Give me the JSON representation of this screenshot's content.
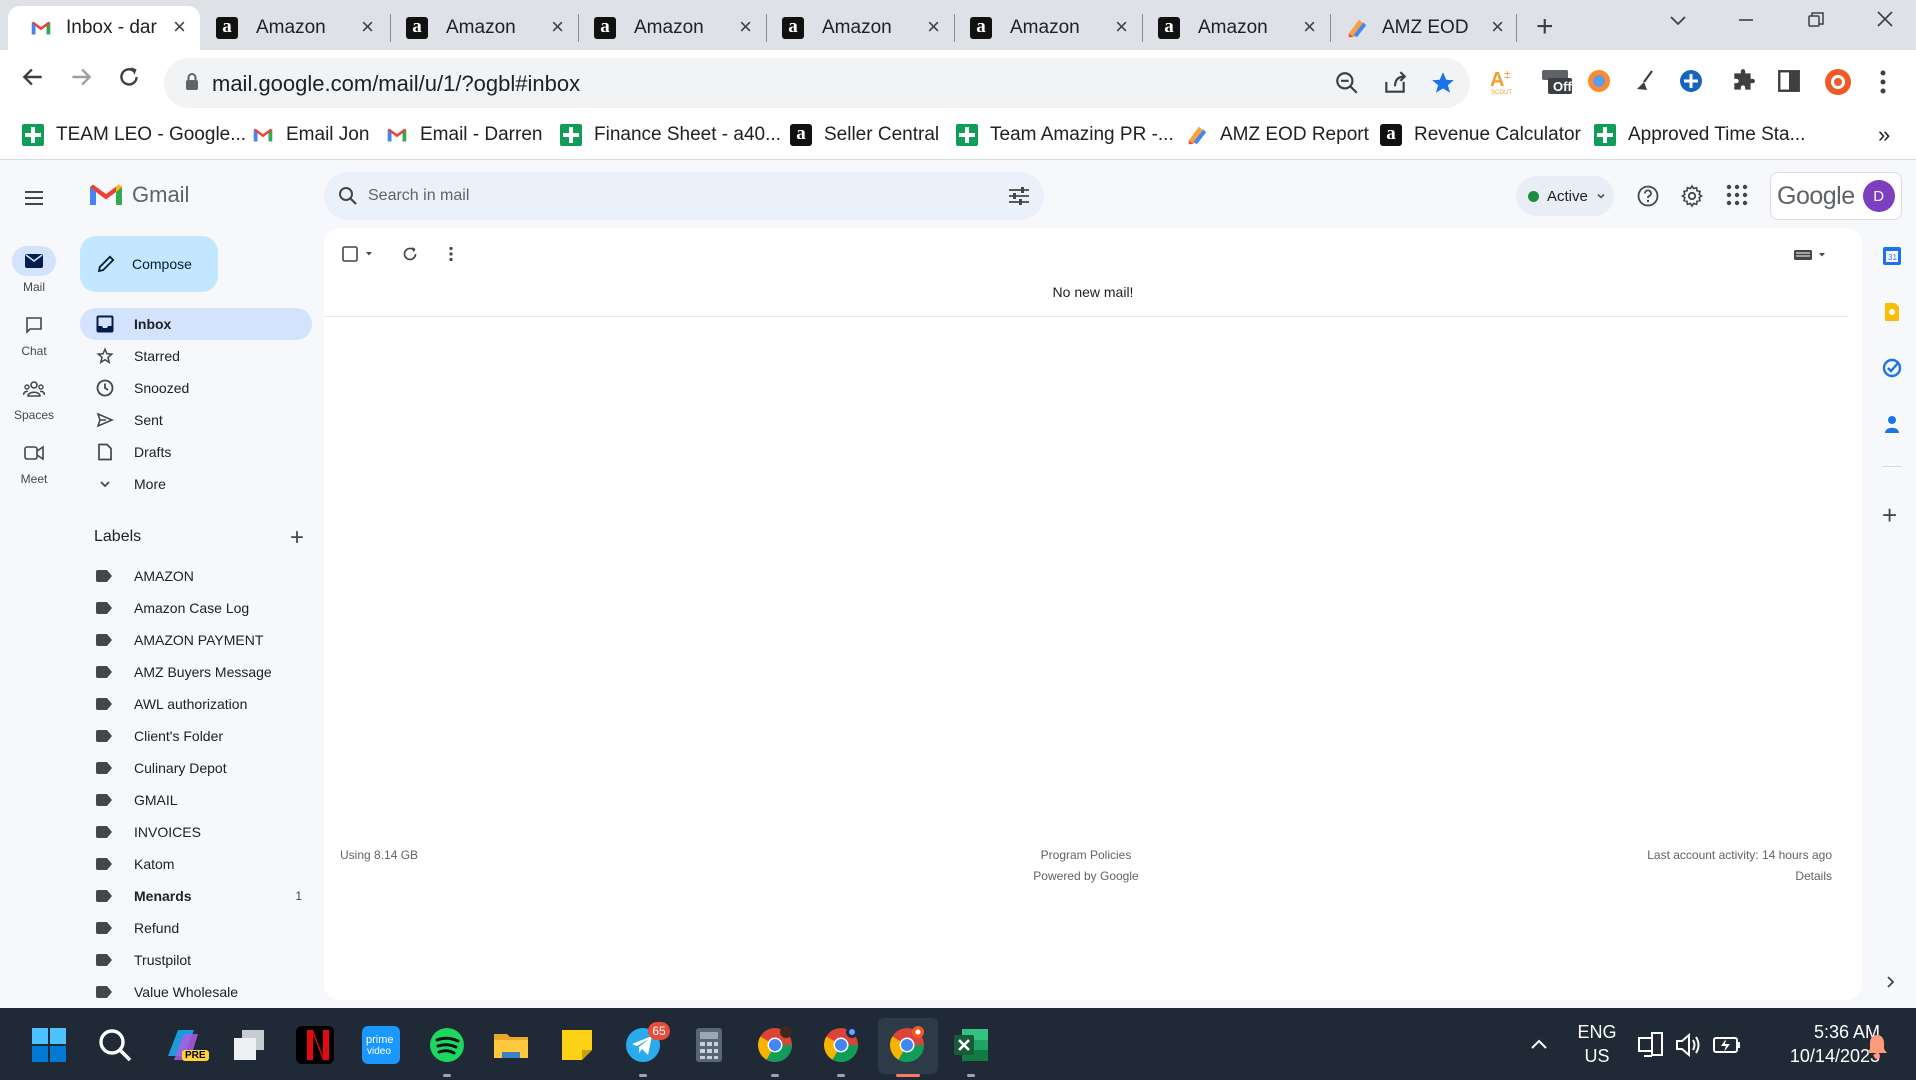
{
  "browser": {
    "tabs": [
      {
        "title": "Inbox - dar",
        "favicon": "gmail-icon",
        "active": true
      },
      {
        "title": "Amazon",
        "favicon": "amazon-icon"
      },
      {
        "title": "Amazon",
        "favicon": "amazon-icon"
      },
      {
        "title": "Amazon",
        "favicon": "amazon-icon"
      },
      {
        "title": "Amazon",
        "favicon": "amazon-icon"
      },
      {
        "title": "Amazon",
        "favicon": "amazon-icon"
      },
      {
        "title": "Amazon",
        "favicon": "amazon-icon"
      },
      {
        "title": "AMZ EOD",
        "favicon": "eod-icon"
      }
    ],
    "url": "mail.google.com/mail/u/1/?ogbl#inbox",
    "ext_off_label": "Off",
    "bookmarks": [
      {
        "label": "TEAM LEO - Google...",
        "icon": "sheets-icon"
      },
      {
        "label": "Email Jon",
        "icon": "gmail-icon"
      },
      {
        "label": "Email - Darren",
        "icon": "gmail-icon"
      },
      {
        "label": "Finance Sheet - a40...",
        "icon": "sheets-icon"
      },
      {
        "label": "Seller Central",
        "icon": "amazon-icon"
      },
      {
        "label": "Team Amazing PR -...",
        "icon": "sheets-icon"
      },
      {
        "label": "AMZ EOD Report",
        "icon": "eod-icon"
      },
      {
        "label": "Revenue Calculator",
        "icon": "amazon-icon"
      },
      {
        "label": "Approved Time Sta...",
        "icon": "sheets-icon"
      }
    ],
    "bookmarks_overflow": "»"
  },
  "gmail": {
    "app_name": "Gmail",
    "search_placeholder": "Search in mail",
    "status": "Active",
    "google_text": "Google",
    "avatar_initial": "D",
    "compose_label": "Compose",
    "rail": [
      {
        "label": "Mail",
        "icon": "mail-icon"
      },
      {
        "label": "Chat",
        "icon": "chat-icon"
      },
      {
        "label": "Spaces",
        "icon": "spaces-icon"
      },
      {
        "label": "Meet",
        "icon": "meet-icon"
      }
    ],
    "nav": [
      {
        "label": "Inbox",
        "icon": "inbox-icon"
      },
      {
        "label": "Starred",
        "icon": "star-icon"
      },
      {
        "label": "Snoozed",
        "icon": "clock-icon"
      },
      {
        "label": "Sent",
        "icon": "send-icon"
      },
      {
        "label": "Drafts",
        "icon": "draft-icon"
      },
      {
        "label": "More",
        "icon": "chevron-down-icon"
      }
    ],
    "labels_title": "Labels",
    "labels": [
      {
        "name": "AMAZON",
        "count": ""
      },
      {
        "name": "Amazon Case Log",
        "count": ""
      },
      {
        "name": "AMAZON PAYMENT",
        "count": ""
      },
      {
        "name": "AMZ Buyers Message",
        "count": ""
      },
      {
        "name": "AWL authorization",
        "count": ""
      },
      {
        "name": "Client's Folder",
        "count": ""
      },
      {
        "name": "Culinary Depot",
        "count": ""
      },
      {
        "name": "GMAIL",
        "count": ""
      },
      {
        "name": "INVOICES",
        "count": ""
      },
      {
        "name": "Katom",
        "count": ""
      },
      {
        "name": "Menards",
        "count": "1"
      },
      {
        "name": "Refund",
        "count": ""
      },
      {
        "name": "Trustpilot",
        "count": ""
      },
      {
        "name": "Value Wholesale",
        "count": ""
      }
    ],
    "empty_message": "No new mail!",
    "footer": {
      "storage": "Using 8.14 GB",
      "policies": "Program Policies",
      "powered": "Powered by Google",
      "last_activity": "Last account activity: 14 hours ago",
      "details": "Details"
    }
  },
  "taskbar": {
    "language": "ENG",
    "region": "US",
    "time": "5:36 AM",
    "date": "10/14/2023",
    "telegram_badge": "65",
    "pre_badge": "PRE"
  },
  "colors": {
    "accent": "#0b57d0",
    "selected_nav": "#d3e3fd",
    "compose": "#c2e7ff",
    "active_status": "#1e8e3e",
    "taskbar": "#1f2a36"
  }
}
